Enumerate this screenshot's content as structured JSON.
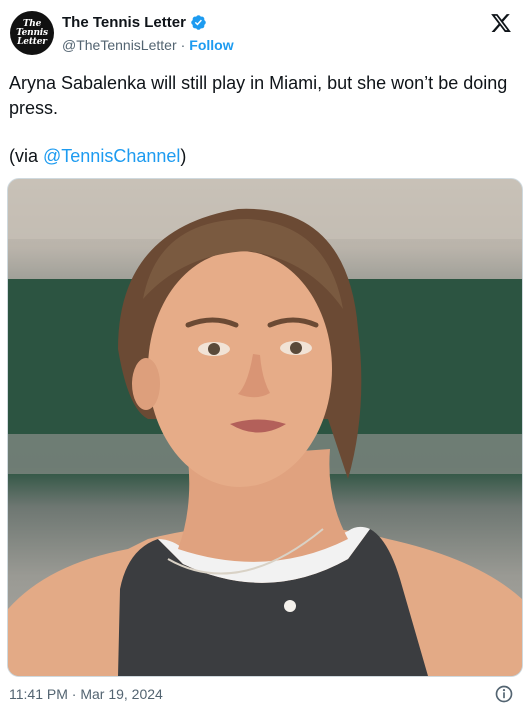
{
  "author": {
    "name": "The Tennis Letter",
    "handle": "@TheTennisLetter",
    "follow_label": "Follow",
    "avatar_text": [
      "The",
      "Tennis",
      "Letter"
    ],
    "verified": true
  },
  "tweet": {
    "text": "Aryna Sabalenka will still play in Miami, but she won’t be doing press.",
    "via_prefix": "(via ",
    "via_mention": "@TennisChannel",
    "via_suffix": ")"
  },
  "media": {
    "icon": "photo-of-tennis-player"
  },
  "footer": {
    "timestamp": "11:41 PM · Mar 19, 2024",
    "info_icon": "info-icon"
  },
  "colors": {
    "accent": "#1d9bf0",
    "text": "#0f1419",
    "secondary": "#536471"
  }
}
